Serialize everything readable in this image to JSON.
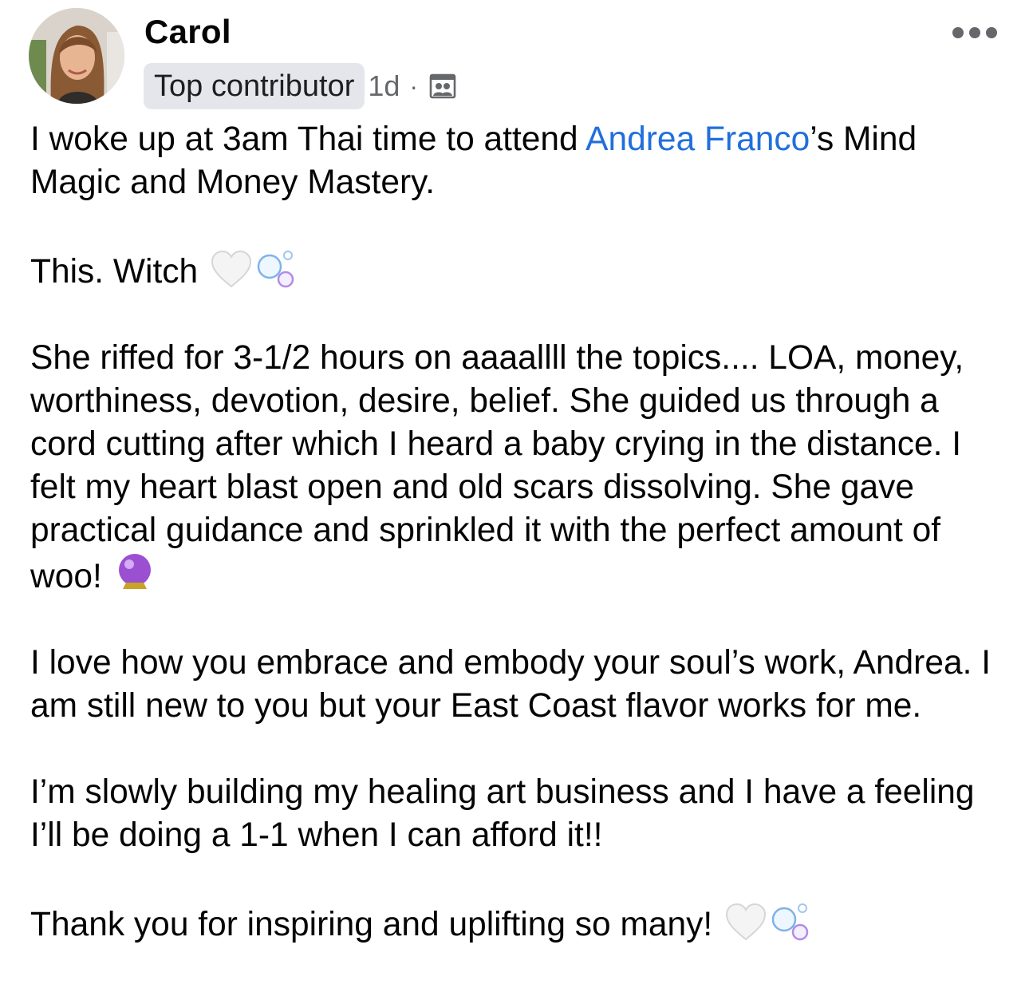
{
  "author": {
    "name": "Carol",
    "badge": "Top contributor",
    "time": "1d",
    "separator": "·",
    "privacy_icon": "group-members-icon",
    "avatar_icon": "profile-photo"
  },
  "menu_icon": "more-options-icon",
  "post": {
    "p1_before": "I woke up at 3am Thai time to attend ",
    "mention": "Andrea Franco",
    "p1_after": "’s Mind Magic and Money Mastery.",
    "p2": "This. Witch",
    "p3": "She riffed for 3-1/2 hours on aaaallll the topics.... LOA, money, worthiness, devotion, desire, belief. She guided us through a cord cutting after which I heard a baby crying in the distance. I felt my heart blast open and old scars dissolving. She gave practical guidance and sprinkled it with the perfect amount of woo!",
    "p4": "I love how you embrace and embody your soul’s work, Andrea. I am still new to you but your East Coast flavor works for me.",
    "p5": "I’m slowly building my healing art business and I have a feeling I’ll be doing a 1-1 when I can afford it!!",
    "p6": "Thank you for inspiring and uplifting so many!"
  },
  "emoji_names": [
    "white-heart-emoji",
    "bubbles-emoji",
    "crystal-ball-emoji"
  ],
  "colors": {
    "link": "#216fdb",
    "badge_bg": "#e4e6eb",
    "secondary_text": "#65676b"
  }
}
